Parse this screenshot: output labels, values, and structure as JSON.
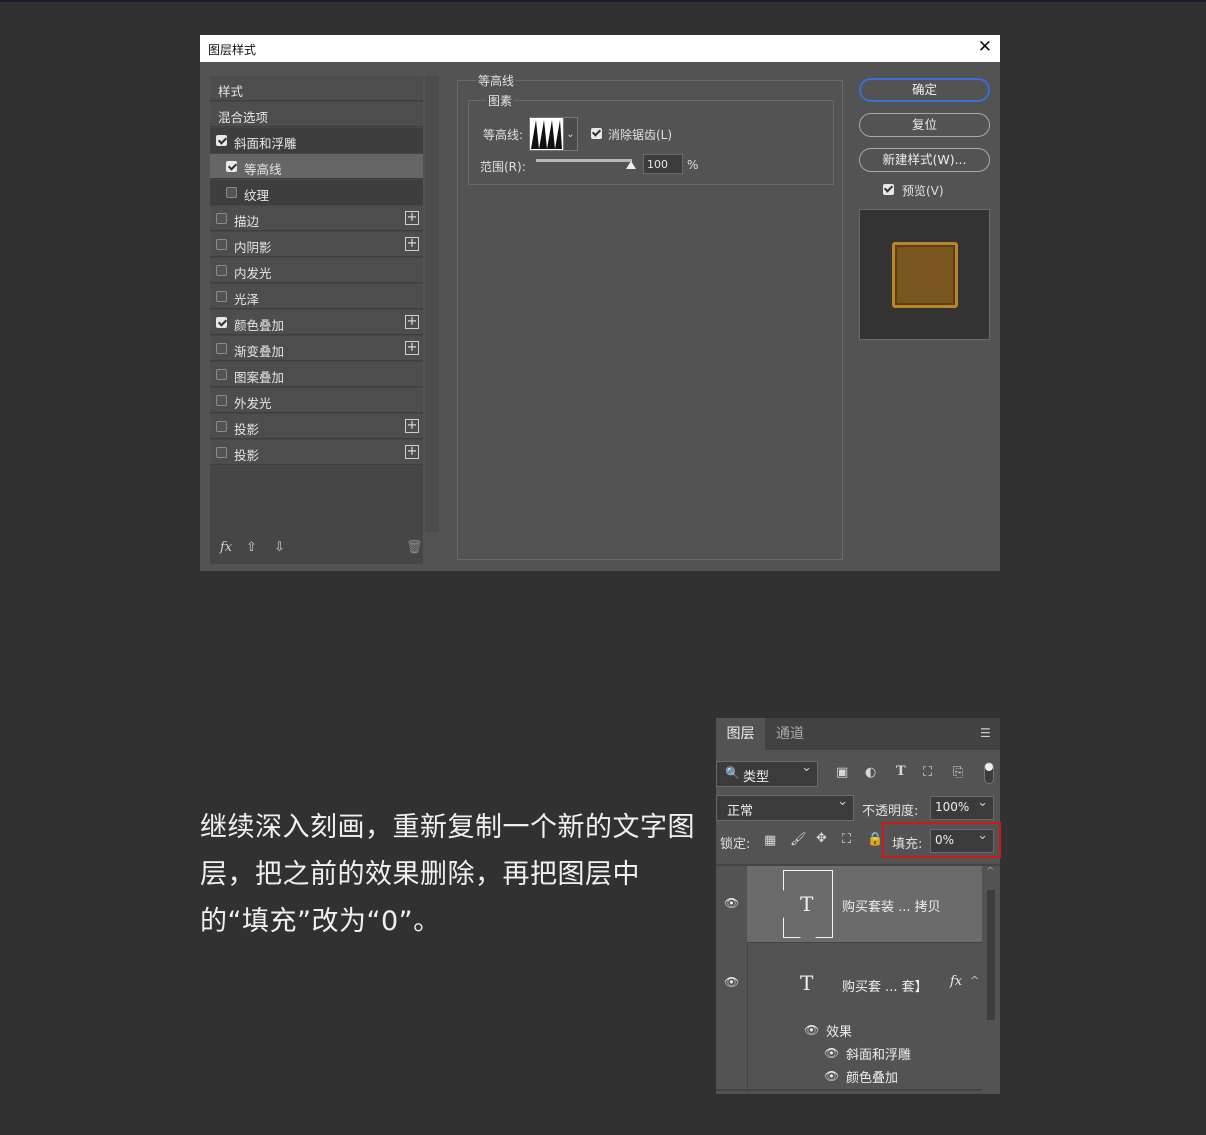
{
  "dialog": {
    "title": "图层样式",
    "close": "✕",
    "styles_header": "样式",
    "blend_options": "混合选项",
    "effects": [
      {
        "label": "斜面和浮雕",
        "checked": true,
        "plus": false
      },
      {
        "label": "等高线",
        "checked": true,
        "plus": false
      },
      {
        "label": "纹理",
        "checked": false,
        "plus": false
      },
      {
        "label": "描边",
        "checked": false,
        "plus": true
      },
      {
        "label": "内阴影",
        "checked": false,
        "plus": true
      },
      {
        "label": "内发光",
        "checked": false,
        "plus": false
      },
      {
        "label": "光泽",
        "checked": false,
        "plus": false
      },
      {
        "label": "颜色叠加",
        "checked": true,
        "plus": true
      },
      {
        "label": "渐变叠加",
        "checked": false,
        "plus": true
      },
      {
        "label": "图案叠加",
        "checked": false,
        "plus": false
      },
      {
        "label": "外发光",
        "checked": false,
        "plus": false
      },
      {
        "label": "投影",
        "checked": false,
        "plus": true
      },
      {
        "label": "投影",
        "checked": false,
        "plus": true
      }
    ],
    "fx_label": "fx",
    "contour_group": "等高线",
    "element_group": "图素",
    "contour_label": "等高线:",
    "antialias_label": "消除锯齿(L)",
    "range_label": "范围(R):",
    "range_value": "100",
    "range_unit": "%",
    "range_fraction": 1.0,
    "buttons": {
      "ok": "确定",
      "reset": "复位",
      "new_style": "新建样式(W)..."
    },
    "preview_label": "预览(V)"
  },
  "caption": "继续深入刻画，重新复制一个新的文字图层，把之前的效果删除，再把图层中的“填充”改为“0”。",
  "layers": {
    "tab_layers": "图层",
    "tab_channels": "通道",
    "filter_type": "类型",
    "blend_mode": "正常",
    "opacity_label": "不透明度:",
    "opacity_value": "100%",
    "lock_label": "锁定:",
    "fill_label": "填充:",
    "fill_value": "0%",
    "rows": [
      {
        "name": "购买套装 ... 拷贝"
      },
      {
        "name": "购买套 ... 套】",
        "fx": "fx"
      }
    ],
    "effects_label": "效果",
    "sub_effects": [
      "斜面和浮雕",
      "颜色叠加"
    ]
  }
}
